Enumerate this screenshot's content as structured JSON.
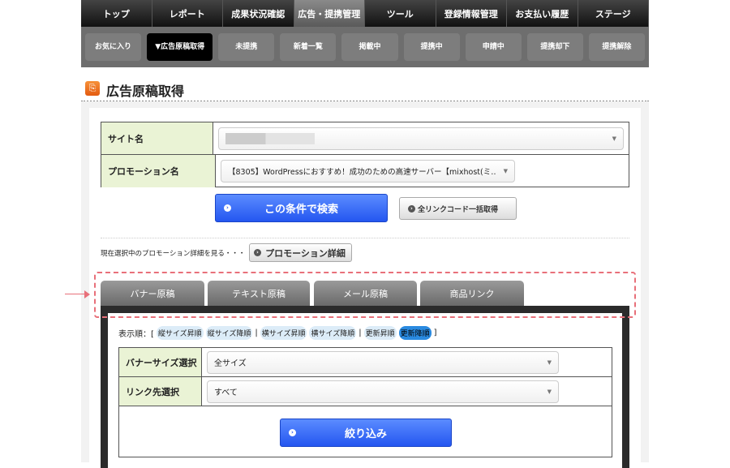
{
  "nav": [
    "トップ",
    "レポート",
    "成果状況確認",
    "広告・提携管理",
    "ツール",
    "登録情報管理",
    "お支払い履歴",
    "ステージ"
  ],
  "nav_active": 3,
  "subnav": [
    "お気に入り",
    "▼広告原稿取得",
    "未提携",
    "新着一覧",
    "掲載中",
    "提携中",
    "申請中",
    "提携却下",
    "提携解除"
  ],
  "subnav_active": 1,
  "page_title": "広告原稿取得",
  "form": {
    "site_label": "サイト名",
    "site_value": "",
    "promo_label": "プロモーション名",
    "promo_value": "【8305】WordPressにおすすめ！成功のための高速サーバー【mixhost(ミ…",
    "search_button": "この条件で検索",
    "all_links_button": "全リンクコード一括取得",
    "promo_detail_text": "現在選択中のプロモーション詳細を見る・・・",
    "promo_detail_button": "プロモーション詳細"
  },
  "tabs": [
    "バナー原稿",
    "テキスト原稿",
    "メール原稿",
    "商品リンク"
  ],
  "tab_active": 0,
  "sort": {
    "label": "表示順：[",
    "items": [
      "縦サイズ昇順",
      "縦サイズ降順",
      "横サイズ昇順",
      "横サイズ降順",
      "更新昇順",
      "更新降順"
    ],
    "active": 5,
    "sep": "|",
    "end": "]"
  },
  "filter": {
    "size_label": "バナーサイズ選択",
    "size_value": "全サイズ",
    "link_label": "リンク先選択",
    "link_value": "すべて",
    "button": "絞り込み"
  },
  "colors": {
    "highlight": "#e8707a",
    "accent": "#2456f0",
    "label_bg": "#eaf3d5"
  }
}
